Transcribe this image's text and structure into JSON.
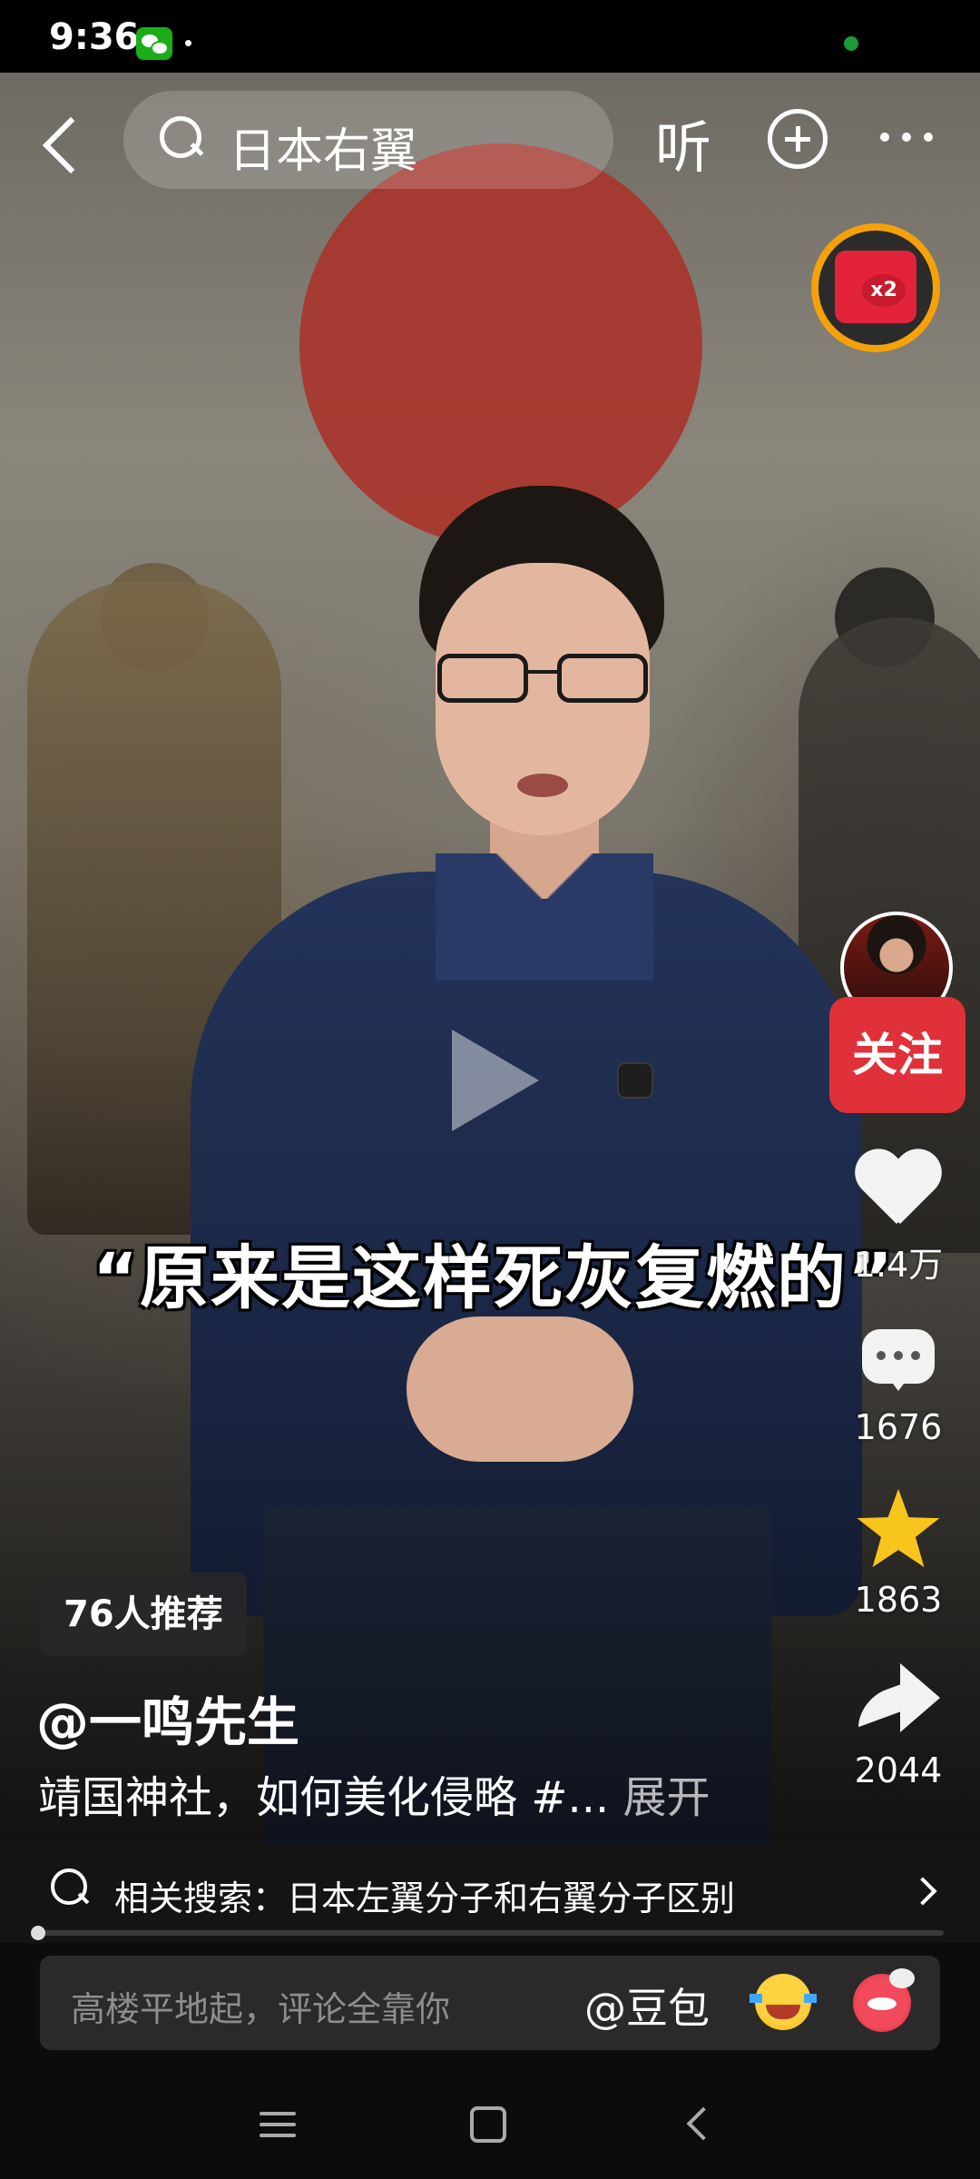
{
  "status_bar": {
    "time": "9:36"
  },
  "top_nav": {
    "search_query": "日本右翼",
    "listen_label": "听"
  },
  "redpacket": {
    "badge": "x2"
  },
  "video": {
    "caption": "“原来是这样死灰复燃的”",
    "progress_fraction": 0.005
  },
  "actions": {
    "follow_label": "关注",
    "likes": "1.4万",
    "comments": "1676",
    "favorites": "1863",
    "shares": "2044"
  },
  "post": {
    "recommend_badge": "76人推荐",
    "author": "@一鸣先生",
    "description": "靖国神社，如何美化侵略 #...",
    "expand_label": "展开"
  },
  "related_search": {
    "text": "相关搜索：日本左翼分子和右翼分子区别"
  },
  "comment_bar": {
    "placeholder": "高楼平地起，评论全靠你",
    "mention": "@豆包"
  },
  "icons": {
    "search": "search-icon",
    "back": "back-icon",
    "add": "plus-circle-icon",
    "more": "more-horizontal-icon",
    "like": "heart-icon",
    "comment": "comment-icon",
    "favorite": "star-icon",
    "share": "share-arrow-icon"
  },
  "colors": {
    "accent_red": "#e0313a",
    "star_yellow": "#f8c51c",
    "redpacket_ring": "#f5a10a"
  }
}
